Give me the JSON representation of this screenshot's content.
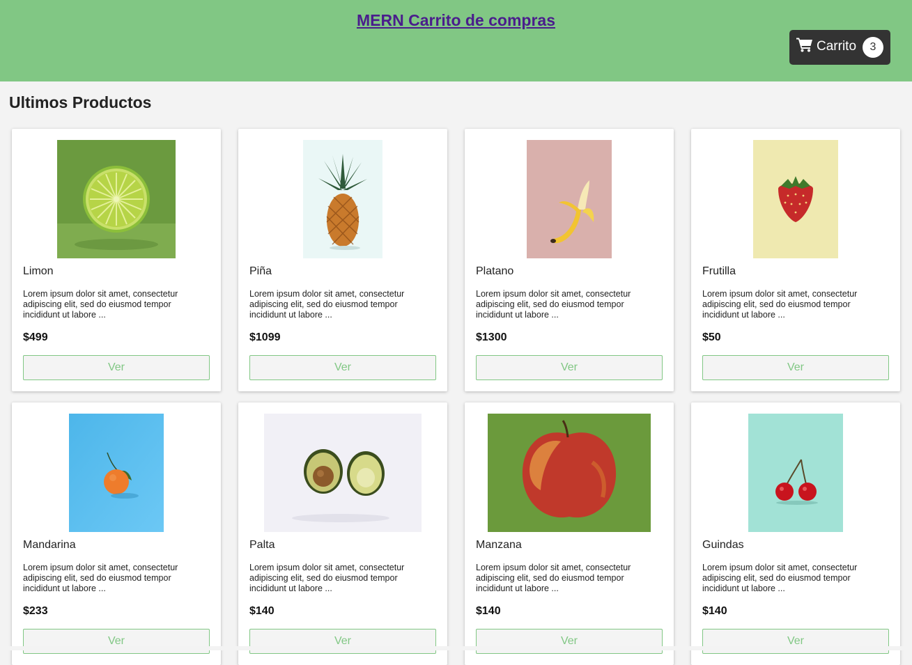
{
  "header": {
    "title": "MERN Carrito de compras",
    "cart_label": "Carrito",
    "cart_count": "3",
    "cart_icon": "shopping-cart-icon",
    "bg_color": "#81c784",
    "title_color": "#4a1d8c"
  },
  "main": {
    "section_title": "Ultimos Productos",
    "button_label": "Ver",
    "products": [
      {
        "name": "Limon",
        "desc": "Lorem ipsum dolor sit amet, consectetur adipiscing elit, sed do eiusmod tempor incididunt ut labore ...",
        "price": "$499",
        "image": "lime-image"
      },
      {
        "name": "Piña",
        "desc": "Lorem ipsum dolor sit amet, consectetur adipiscing elit, sed do eiusmod tempor incididunt ut labore ...",
        "price": "$1099",
        "image": "pineapple-image"
      },
      {
        "name": "Platano",
        "desc": "Lorem ipsum dolor sit amet, consectetur adipiscing elit, sed do eiusmod tempor incididunt ut labore ...",
        "price": "$1300",
        "image": "banana-image"
      },
      {
        "name": "Frutilla",
        "desc": "Lorem ipsum dolor sit amet, consectetur adipiscing elit, sed do eiusmod tempor incididunt ut labore ...",
        "price": "$50",
        "image": "strawberry-image"
      },
      {
        "name": "Mandarina",
        "desc": "Lorem ipsum dolor sit amet, consectetur adipiscing elit, sed do eiusmod tempor incididunt ut labore ...",
        "price": "$233",
        "image": "tangerine-image"
      },
      {
        "name": "Palta",
        "desc": "Lorem ipsum dolor sit amet, consectetur adipiscing elit, sed do eiusmod tempor incididunt ut labore ...",
        "price": "$140",
        "image": "avocado-image"
      },
      {
        "name": "Manzana",
        "desc": "Lorem ipsum dolor sit amet, consectetur adipiscing elit, sed do eiusmod tempor incididunt ut labore ...",
        "price": "$140",
        "image": "apple-image"
      },
      {
        "name": "Guindas",
        "desc": "Lorem ipsum dolor sit amet, consectetur adipiscing elit, sed do eiusmod tempor incididunt ut labore ...",
        "price": "$140",
        "image": "cherries-image"
      }
    ]
  }
}
